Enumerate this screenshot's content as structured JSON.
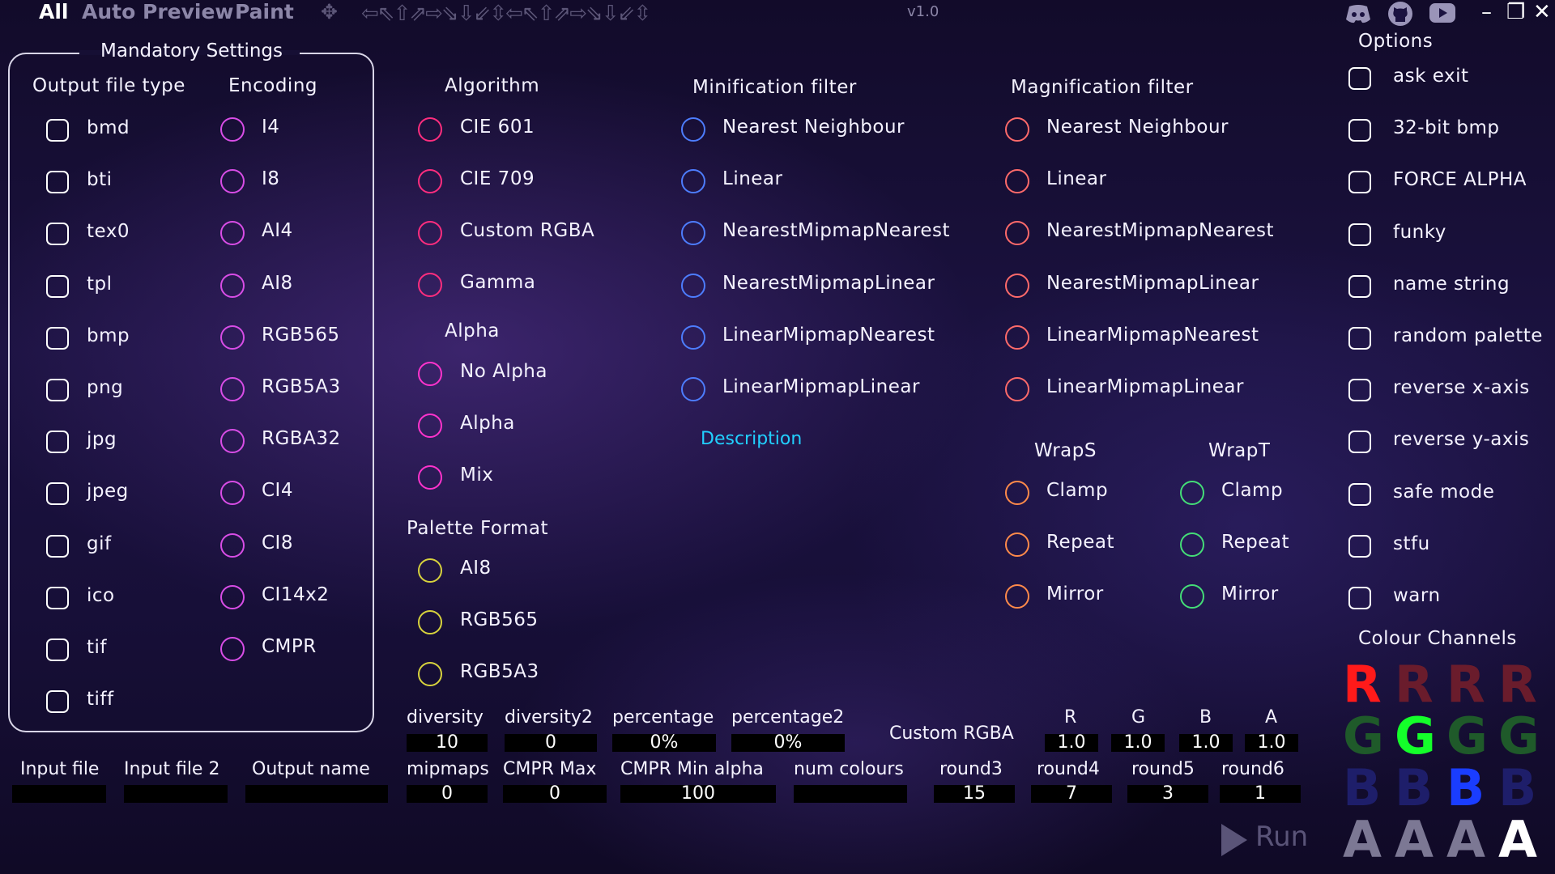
{
  "topbar": {
    "tabs": [
      "All",
      "Auto",
      "Preview",
      "Paint"
    ],
    "move_icon": "✥",
    "arrow_icons": "⇦⇖⇧⇗⇨⇘⇩⇙⇳⇦⇖⇧⇗⇨⇘⇩⇙⇳",
    "version": "v1.0",
    "discord_icon": "discord-icon",
    "github_icon": "github-icon",
    "youtube_icon": "youtube-icon",
    "minimize": "–",
    "maximize": "❐",
    "close": "✕"
  },
  "mandatory": {
    "legend": "Mandatory Settings",
    "output_header": "Output file type",
    "encoding_header": "Encoding",
    "output_types": [
      "bmd",
      "bti",
      "tex0",
      "tpl",
      "bmp",
      "png",
      "jpg",
      "jpeg",
      "gif",
      "ico",
      "tif",
      "tiff"
    ],
    "encodings": [
      "I4",
      "I8",
      "AI4",
      "AI8",
      "RGB565",
      "RGB5A3",
      "RGBA32",
      "CI4",
      "CI8",
      "CI14x2",
      "CMPR"
    ]
  },
  "algorithm": {
    "header": "Algorithm",
    "items": [
      "CIE 601",
      "CIE 709",
      "Custom RGBA",
      "Gamma"
    ]
  },
  "alpha": {
    "header": "Alpha",
    "items": [
      "No Alpha",
      "Alpha",
      "Mix"
    ]
  },
  "palette": {
    "header": "Palette Format",
    "items": [
      "AI8",
      "RGB565",
      "RGB5A3"
    ]
  },
  "minification": {
    "header": "Minification filter",
    "items": [
      "Nearest Neighbour",
      "Linear",
      "NearestMipmapNearest",
      "NearestMipmapLinear",
      "LinearMipmapNearest",
      "LinearMipmapLinear"
    ]
  },
  "magnification": {
    "header": "Magnification filter",
    "items": [
      "Nearest Neighbour",
      "Linear",
      "NearestMipmapNearest",
      "NearestMipmapLinear",
      "LinearMipmapNearest",
      "LinearMipmapLinear"
    ]
  },
  "description_link": "Description",
  "wraps": {
    "header": "WrapS",
    "items": [
      "Clamp",
      "Repeat",
      "Mirror"
    ]
  },
  "wrapt": {
    "header": "WrapT",
    "items": [
      "Clamp",
      "Repeat",
      "Mirror"
    ]
  },
  "options": {
    "header": "Options",
    "items": [
      "ask exit",
      "32-bit bmp",
      "FORCE ALPHA",
      "funky",
      "name string",
      "random palette",
      "reverse x-axis",
      "reverse y-axis",
      "safe mode",
      "stfu",
      "warn"
    ]
  },
  "colour_channels": {
    "header": "Colour Channels",
    "rows": [
      {
        "letter": "R",
        "selected": 0
      },
      {
        "letter": "G",
        "selected": 1
      },
      {
        "letter": "B",
        "selected": 2
      },
      {
        "letter": "A",
        "selected": 3
      }
    ]
  },
  "fields": {
    "input_file": {
      "label": "Input file",
      "value": ""
    },
    "input_file2": {
      "label": "Input file 2",
      "value": ""
    },
    "output_name": {
      "label": "Output name",
      "value": ""
    },
    "diversity": {
      "label": "diversity",
      "value": "10"
    },
    "diversity2": {
      "label": "diversity2",
      "value": "0"
    },
    "percentage": {
      "label": "percentage",
      "value": "0%"
    },
    "percentage2": {
      "label": "percentage2",
      "value": "0%"
    },
    "custom_rgba_label": "Custom RGBA",
    "r": {
      "label": "R",
      "value": "1.0"
    },
    "g": {
      "label": "G",
      "value": "1.0"
    },
    "b": {
      "label": "B",
      "value": "1.0"
    },
    "a": {
      "label": "A",
      "value": "1.0"
    },
    "mipmaps": {
      "label": "mipmaps",
      "value": "0"
    },
    "cmpr_max": {
      "label": "CMPR Max",
      "value": "0"
    },
    "cmpr_min_alpha": {
      "label": "CMPR Min alpha",
      "value": "100"
    },
    "num_colours": {
      "label": "num colours",
      "value": ""
    },
    "round3": {
      "label": "round3",
      "value": "15"
    },
    "round4": {
      "label": "round4",
      "value": "7"
    },
    "round5": {
      "label": "round5",
      "value": "3"
    },
    "round6": {
      "label": "round6",
      "value": "1"
    }
  },
  "run_button": "Run"
}
